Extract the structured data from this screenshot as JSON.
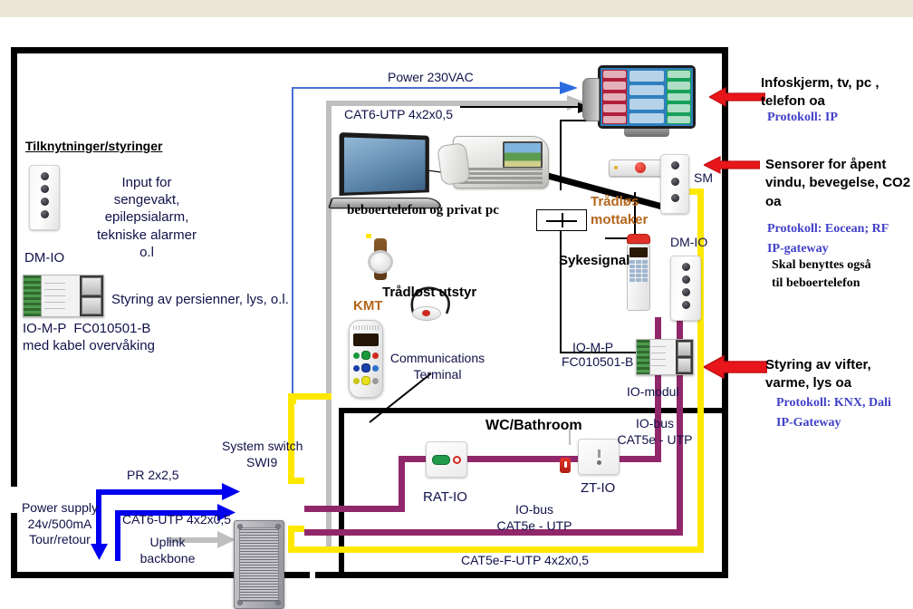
{
  "diagram": {
    "left_panel": {
      "heading": "Tilknytninger/styringer",
      "dm_io_label": "DM-IO",
      "dm_io_desc": "Input for\nsengevakt,\nepilepsialarm,\ntekniske alarmer\no.l",
      "io_mp_desc": "Styring av persienner, lys, o.l.",
      "io_mp_label": "IO-M-P  FC010501-B",
      "io_mp_label2": "med kabel overvåking"
    },
    "cables": {
      "power_230vac": "Power 230VAC",
      "cat6_utp_top": "CAT6-UTP 4x2x0,5",
      "pr_2x25": "PR 2x2,5",
      "cat6_utp_switch": "CAT6-UTP 4x2x0,5",
      "uplink_backbone": "Uplink\nbackbone",
      "power_supply": "Power supply\n24v/500mA\nTour/retour",
      "io_bus_right": "IO-bus\nCAT5e - UTP",
      "io_bus_bottom": "IO-bus\nCAT5e - UTP",
      "cat5e_f_utp": "CAT5e-F-UTP 4x2x0,5"
    },
    "center": {
      "beboertelefon": "beboertelefon og privat pc",
      "tradlost_utstyr": "Trådløst utstyr",
      "kmt": "KMT",
      "communications_terminal": "Communications\nTerminal",
      "tradlos_mottaker": "Trådløs\nmottaker",
      "sykesignal": "Sykesignal",
      "sm": "SM",
      "dm_io": "DM-IO",
      "io_mp": "IO-M-P",
      "io_mp_code": "FC010501-B",
      "io_modul": "IO-modul"
    },
    "bathroom": {
      "title": "WC/Bathroom",
      "rat_io": "RAT-IO",
      "zt_io": "ZT-IO"
    },
    "switch": {
      "title": "System switch",
      "model": "SWI9"
    },
    "annotations": [
      {
        "title": "Infoskjerm, tv, pc ,\ntelefon oa",
        "protocol": "Protokoll: IP",
        "note": ""
      },
      {
        "title": "Sensorer for åpent\nvindu, bevegelse, CO2\noa",
        "protocol": "Protokoll: Eocean; RF\nIP-gateway",
        "note": "Skal benyttes også\ntil beboertelefon"
      },
      {
        "title": "Styring av vifter,\nvarme, lys oa",
        "protocol": "Protokoll: KNX, Dali\nIP-Gateway",
        "note": ""
      }
    ],
    "colors": {
      "band": "#eae7d6",
      "wall": "#000000",
      "arrow_red": "#e8161a",
      "cable_yellow": "#ffe800",
      "cable_purple": "#91276b",
      "cable_blue": "#0000ee",
      "cable_gray": "#bfbfbf",
      "protocol_text": "#4040c8",
      "device_label": "#b4661b"
    }
  }
}
